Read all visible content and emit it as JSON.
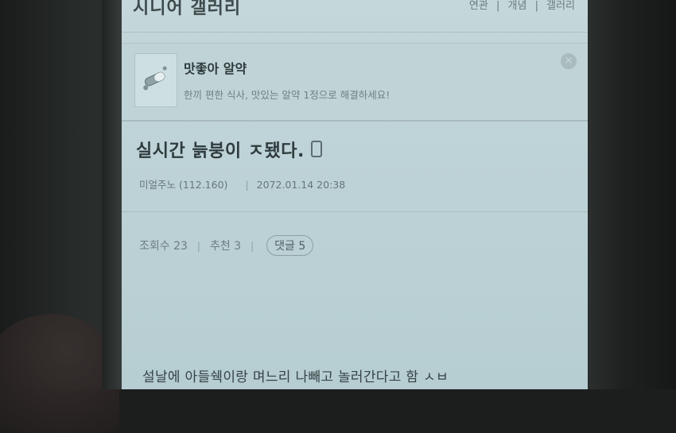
{
  "header": {
    "title": "시니어 갤러리",
    "links": [
      "연관",
      "개념",
      "갤러리"
    ]
  },
  "ad": {
    "title": "맛좋아 알약",
    "description": "한끼 편한 식사, 맛있는 알약 1정으로 해결하세요!",
    "close_icon": "close-icon"
  },
  "post": {
    "title": "실시간 늙붕이 ㅈ됐다.",
    "author": "미얼주노 (112.160)",
    "datetime": "2072.01.14  20:38",
    "views": "조회수 23",
    "recommend": "추천 3",
    "comments": "댓글 5",
    "body_first_line": "설날에 아들쉑이랑 며느리 나빼고 놀러간다고 함 ㅅㅂ"
  },
  "colors": {
    "screen_bg": "#c4d7da",
    "text_dark": "#2f3b3d",
    "text_muted": "#6c7d80"
  }
}
